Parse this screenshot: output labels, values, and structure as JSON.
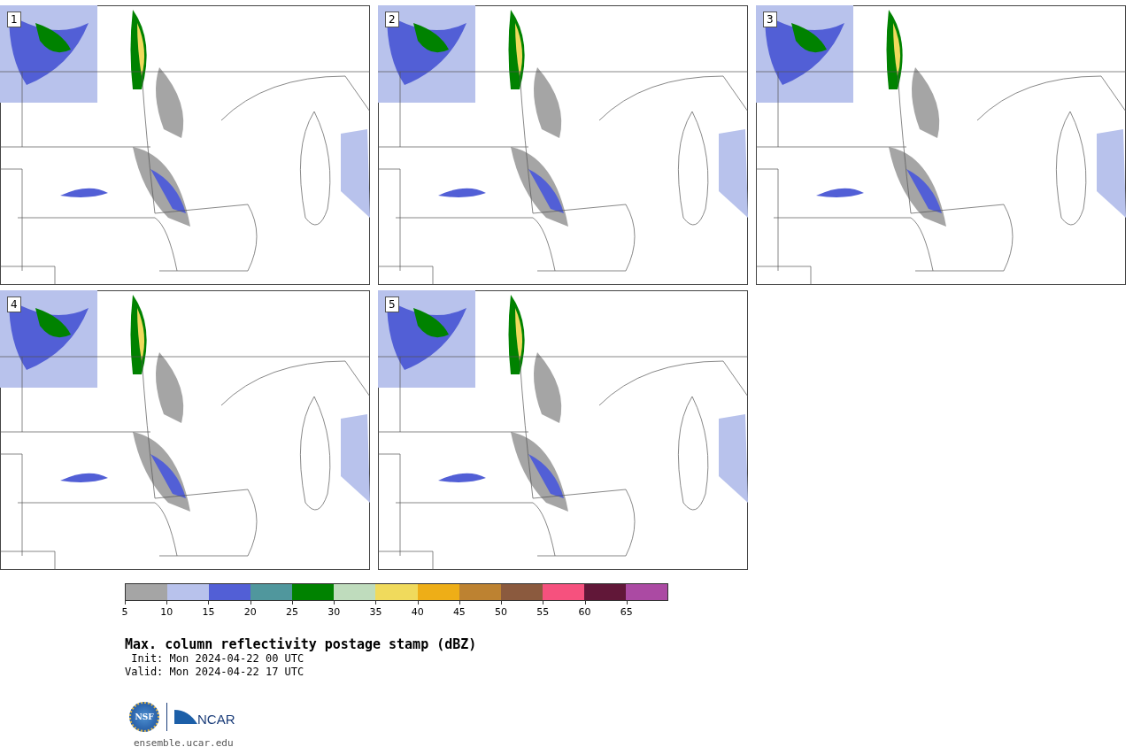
{
  "panels": [
    {
      "label": "1"
    },
    {
      "label": "2"
    },
    {
      "label": "3"
    },
    {
      "label": "4"
    },
    {
      "label": "5"
    }
  ],
  "colorbar": {
    "bins": [
      {
        "color": "#a5a5a5"
      },
      {
        "color": "#b8c2ec"
      },
      {
        "color": "#525fd6"
      },
      {
        "color": "#50979d"
      },
      {
        "color": "#008200"
      },
      {
        "color": "#bfdcbd"
      },
      {
        "color": "#f0da5c"
      },
      {
        "color": "#eeae17"
      },
      {
        "color": "#bd8231"
      },
      {
        "color": "#8b5a3e"
      },
      {
        "color": "#f6517e"
      },
      {
        "color": "#611738"
      },
      {
        "color": "#ab4aa3"
      }
    ],
    "ticks": [
      "5",
      "10",
      "15",
      "20",
      "25",
      "30",
      "35",
      "40",
      "45",
      "50",
      "55",
      "60",
      "65"
    ]
  },
  "title": "Max. column reflectivity postage stamp (dBZ)",
  "init": " Init: Mon 2024-04-22 00 UTC",
  "valid": "Valid: Mon 2024-04-22 17 UTC",
  "logos": {
    "left": "NSF",
    "right": "NCAR"
  },
  "footer": "ensemble.ucar.edu"
}
